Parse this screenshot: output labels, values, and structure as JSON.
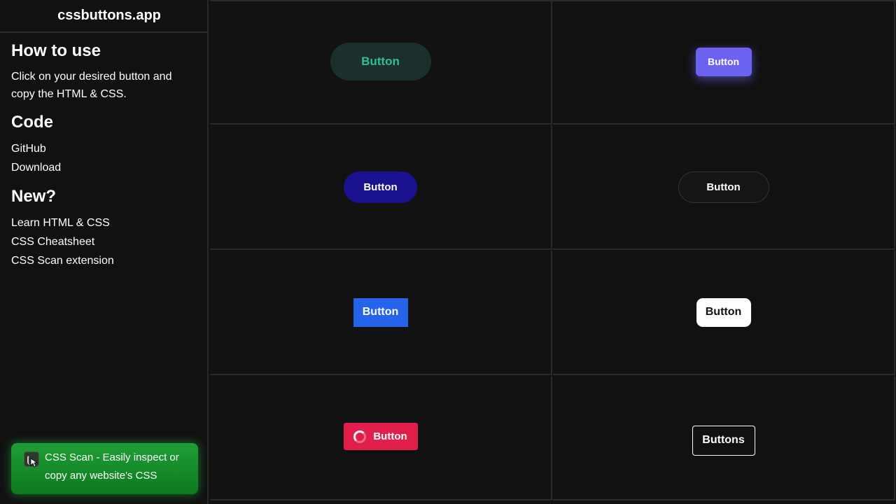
{
  "site_title": "cssbuttons.app",
  "sidebar": {
    "how_to_use": {
      "heading": "How to use",
      "text": "Click on your desired button and copy the HTML & CSS."
    },
    "code": {
      "heading": "Code",
      "links": [
        "GitHub",
        "Download"
      ]
    },
    "new": {
      "heading": "New?",
      "links": [
        "Learn HTML & CSS",
        "CSS Cheatsheet",
        "CSS Scan extension"
      ]
    },
    "promo": {
      "icon": "css-scan-icon",
      "text": "CSS Scan - Easily inspect or copy any website's CSS"
    }
  },
  "buttons": [
    {
      "label": "Button",
      "bg": "#1b2f2c",
      "fg": "#2ec090"
    },
    {
      "label": "Button",
      "bg": "#6b63f0",
      "fg": "#ffffff"
    },
    {
      "label": "Button",
      "bg": "#1a118f",
      "fg": "#ffffff"
    },
    {
      "label": "Button",
      "bg": "#151515",
      "fg": "#ffffff"
    },
    {
      "label": "Button",
      "bg": "#2563eb",
      "fg": "#ffffff"
    },
    {
      "label": "Button",
      "bg": "#ffffff",
      "fg": "#111111"
    },
    {
      "label": "Button",
      "bg": "#e0204a",
      "fg": "#ffffff",
      "icon": "spinner-icon"
    },
    {
      "label": "Buttons",
      "bg": "transparent",
      "fg": "#ffffff"
    }
  ],
  "colors": {
    "background": "#111111",
    "border": "#2a2a2a",
    "promo_green": "#1f9e35"
  }
}
